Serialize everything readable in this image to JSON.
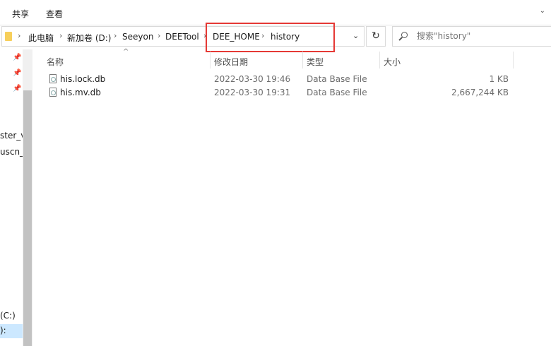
{
  "ribbon": {
    "tabs": [
      "共享",
      "查看"
    ],
    "expand_icon": "chevron-down-icon"
  },
  "address": {
    "folder_icon": "folder-icon",
    "crumbs": [
      "此电脑",
      "新加卷 (D:)",
      "Seeyon",
      "DEETool",
      "DEE_HOME",
      "history"
    ],
    "separator_icon": "chevron-right-icon",
    "dropdown_icon": "chevron-down-icon"
  },
  "refresh": {
    "icon": "refresh-icon",
    "glyph": "↻"
  },
  "search": {
    "placeholder": "搜索\"history\"",
    "icon": "search-icon"
  },
  "highlight": {
    "color": "#e53935"
  },
  "nav": {
    "pins": [
      "pin-icon",
      "pin-icon",
      "pin-icon"
    ],
    "items": [
      "ster_v",
      "uscn_b",
      "(C:)",
      "):"
    ]
  },
  "columns": {
    "name": "名称",
    "date": "修改日期",
    "type": "类型",
    "size": "大小"
  },
  "files": [
    {
      "name": "his.lock.db",
      "date": "2022-03-30 19:46",
      "type": "Data Base File",
      "size": "1 KB"
    },
    {
      "name": "his.mv.db",
      "date": "2022-03-30 19:31",
      "type": "Data Base File",
      "size": "2,667,244 KB"
    }
  ]
}
